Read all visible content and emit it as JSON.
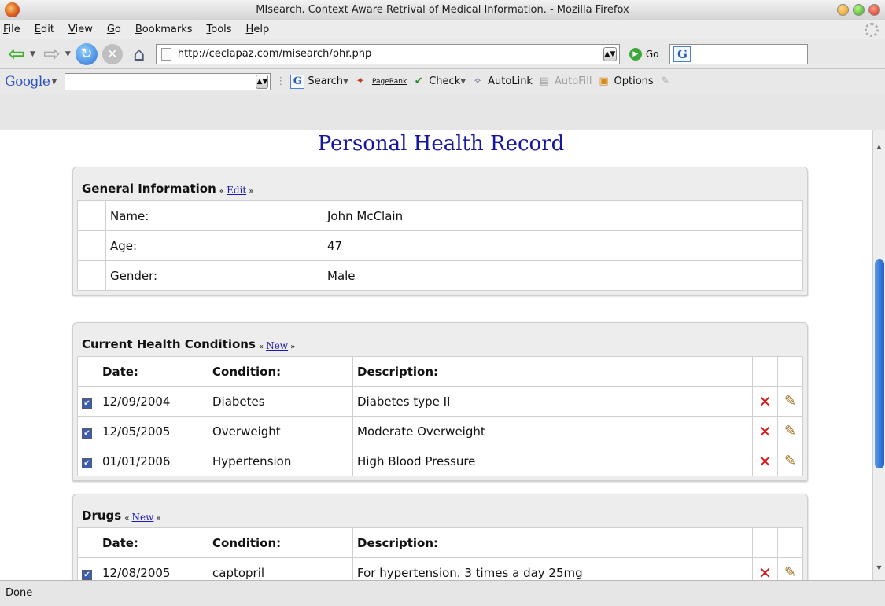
{
  "window": {
    "title": "MIsearch. Context Aware Retrival of Medical Information. - Mozilla Firefox"
  },
  "menu": [
    "File",
    "Edit",
    "View",
    "Go",
    "Bookmarks",
    "Tools",
    "Help"
  ],
  "navbar": {
    "url": "http://ceclapaz.com/misearch/phr.php",
    "go_label": "Go"
  },
  "google_toolbar": {
    "logo": "Google",
    "search_label": "Search",
    "pagerank_label": "PageRank",
    "check_label": "Check",
    "autolink_label": "AutoLink",
    "autofill_label": "AutoFill",
    "options_label": "Options"
  },
  "page": {
    "heading": "Personal Health Record"
  },
  "general": {
    "title": "General Information",
    "action": "Edit",
    "rows": [
      {
        "label": "Name:",
        "value": "John McClain"
      },
      {
        "label": "Age:",
        "value": "47"
      },
      {
        "label": "Gender:",
        "value": "Male"
      }
    ]
  },
  "conditions": {
    "title": "Current Health Conditions",
    "action": "New",
    "headers": {
      "date": "Date:",
      "condition": "Condition:",
      "description": "Description:"
    },
    "rows": [
      {
        "date": "12/09/2004",
        "condition": "Diabetes",
        "description": "Diabetes type II"
      },
      {
        "date": "12/05/2005",
        "condition": "Overweight",
        "description": "Moderate Overweight"
      },
      {
        "date": "01/01/2006",
        "condition": "Hypertension",
        "description": "High Blood Pressure"
      }
    ]
  },
  "drugs": {
    "title": "Drugs",
    "action": "New",
    "headers": {
      "date": "Date:",
      "condition": "Condition:",
      "description": "Description:"
    },
    "rows": [
      {
        "date": "12/08/2005",
        "condition": "captopril",
        "description": "For hypertension. 3 times a day 25mg"
      }
    ]
  },
  "status": {
    "text": "Done"
  }
}
